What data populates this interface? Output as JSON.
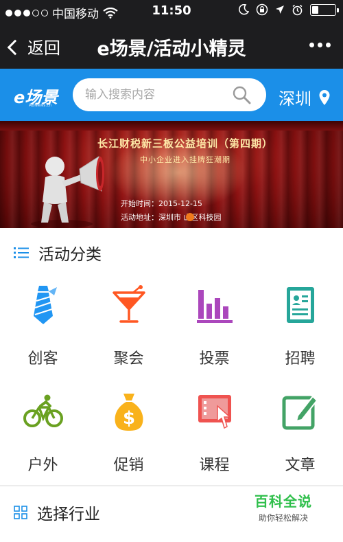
{
  "status_bar": {
    "carrier": "中国移动",
    "time": "11:50"
  },
  "nav": {
    "back_label": "返回",
    "title": "e场景/活动小精灵"
  },
  "header": {
    "logo_text": "e场景",
    "logo_sub": "ABNews.cn",
    "search_placeholder": "输入搜索内容",
    "city": "深圳"
  },
  "banner": {
    "title": "长江财税新三板公益培训（第四期）",
    "subtitle": "中小企业进入挂牌狂潮期",
    "start_time": "开始时间：2015-12-15",
    "address": "活动地址：深圳市  山区科技园"
  },
  "categories": {
    "heading": "活动分类",
    "items": [
      {
        "label": "创客",
        "icon": "tie-icon",
        "color": "#2196f3"
      },
      {
        "label": "聚会",
        "icon": "cocktail-icon",
        "color": "#ff5722"
      },
      {
        "label": "投票",
        "icon": "bar-chart-icon",
        "color": "#9c27b0"
      },
      {
        "label": "招聘",
        "icon": "resume-icon",
        "color": "#26a69a"
      },
      {
        "label": "户外",
        "icon": "bicycle-icon",
        "color": "#6aa121"
      },
      {
        "label": "促销",
        "icon": "money-bag-icon",
        "color": "#f9b21b"
      },
      {
        "label": "课程",
        "icon": "course-icon",
        "color": "#ef5350"
      },
      {
        "label": "文章",
        "icon": "edit-icon",
        "color": "#43a366"
      }
    ]
  },
  "industry": {
    "heading": "选择行业"
  },
  "watermark": {
    "title": "百科全说",
    "subtitle": "助你轻松解决"
  },
  "colors": {
    "header_blue": "#1b8fe8",
    "nav_dark": "#1d1d1f"
  }
}
